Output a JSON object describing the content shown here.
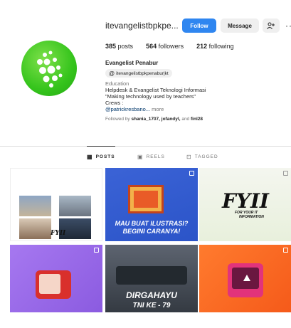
{
  "profile": {
    "username": "itevangelistbpkpe...",
    "follow_label": "Follow",
    "message_label": "Message",
    "add_user_icon": "add-user-icon",
    "more_icon": "more-horizontal-icon",
    "more_glyph": "···",
    "stats": {
      "posts_count": "385",
      "posts_label": "posts",
      "followers_count": "564",
      "followers_label": "followers",
      "following_count": "212",
      "following_label": "following"
    },
    "display_name": "Evangelist Penabur",
    "threads_handle": "itevangelistbpkpenabur|kt",
    "category": "Education",
    "bio_line1": "Helpdesk & Evangelist Teknologi Informasi",
    "bio_line2": "\"Making technology used by teachers\"",
    "bio_line3": "Crews :",
    "bio_mention": "@patrickresbano...",
    "bio_more": "more",
    "followed_by_prefix": "Followed by",
    "followed_by_names": "shania_1707, jofandyl,",
    "followed_by_and": "and",
    "followed_by_last": "finl28"
  },
  "tabs": [
    {
      "label": "POSTS",
      "icon": "grid-icon",
      "glyph": "▦",
      "active": true
    },
    {
      "label": "REELS",
      "icon": "reels-icon",
      "glyph": "▣",
      "active": false
    },
    {
      "label": "TAGGED",
      "icon": "tagged-icon",
      "glyph": "⊡",
      "active": false
    }
  ],
  "posts": {
    "p1": {
      "logo": "FYII"
    },
    "p2": {
      "line1": "MAU BUAT ILUSTRASI?",
      "line2": "BEGINI CARANYA!"
    },
    "p3": {
      "title": "FYII",
      "sub1": "FOR YOUR IT",
      "sub2": "INFORMATION"
    },
    "p5": {
      "line1": "DIRGAHAYU",
      "line2": "TNI KE - 79"
    }
  },
  "colors": {
    "follow_button": "#2f86f0",
    "avatar_green": "#35c41c",
    "post2_blue": "#2b54c8",
    "post4_purple": "#8b5be0",
    "post6_orange": "#f55a1a"
  }
}
